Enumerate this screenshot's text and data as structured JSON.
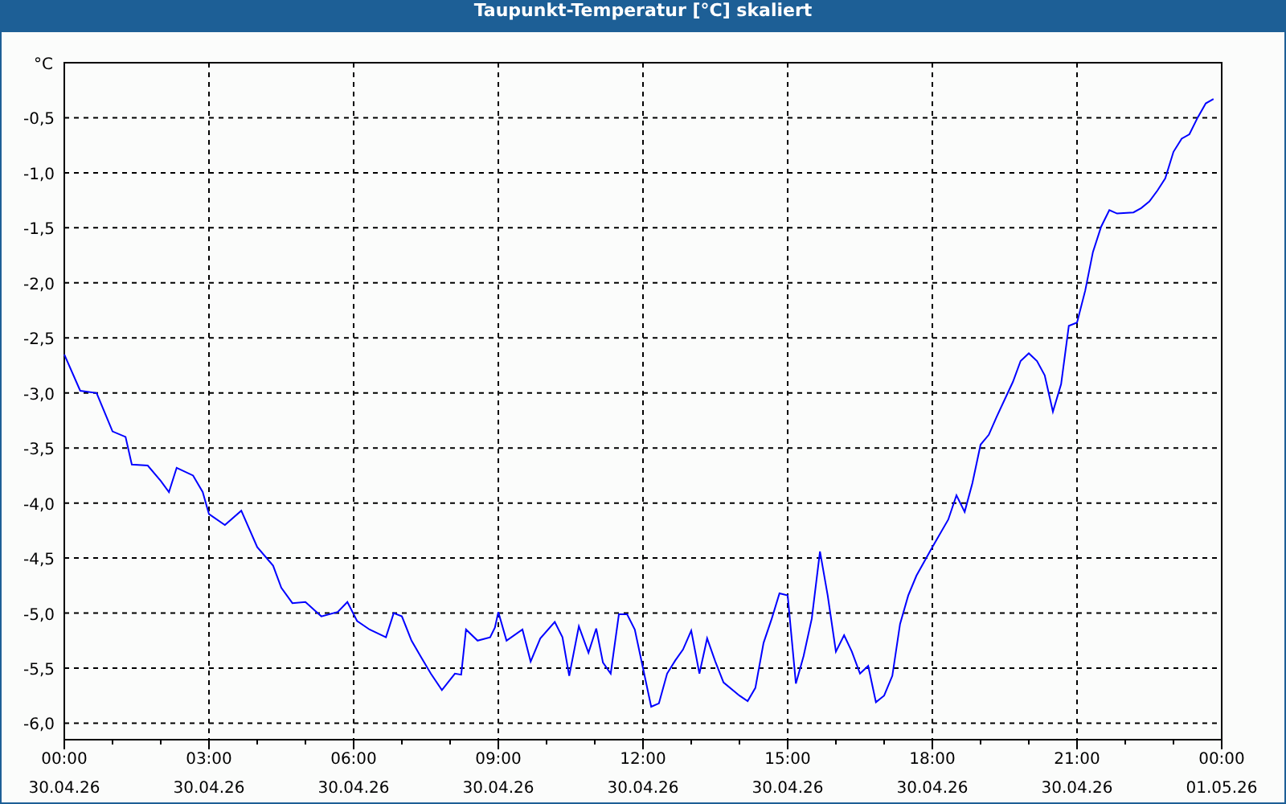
{
  "window": {
    "title": "Taupunkt-Temperatur [°C] skaliert"
  },
  "chart": {
    "chart_data": {
      "type": "line",
      "ylabel": "°C",
      "xlim": [
        0,
        24
      ],
      "ylim": [
        -6.15,
        0
      ],
      "xticks": [
        {
          "value": 0,
          "label": "00:00"
        },
        {
          "value": 3,
          "label": "03:00"
        },
        {
          "value": 6,
          "label": "06:00"
        },
        {
          "value": 9,
          "label": "09:00"
        },
        {
          "value": 12,
          "label": "12:00"
        },
        {
          "value": 15,
          "label": "15:00"
        },
        {
          "value": 18,
          "label": "18:00"
        },
        {
          "value": 21,
          "label": "21:00"
        },
        {
          "value": 24,
          "label": "00:00"
        }
      ],
      "annotations": [
        "30.04.26",
        "30.04.26",
        "30.04.26",
        "30.04.26",
        "30.04.26",
        "30.04.26",
        "30.04.26",
        "30.04.26",
        "01.05.26"
      ],
      "grid": true,
      "yticks": [
        {
          "value": -0.5,
          "label": "-0,5"
        },
        {
          "value": -1,
          "label": "-1,0"
        },
        {
          "value": -1.5,
          "label": "-1,5"
        },
        {
          "value": -2,
          "label": "-2,0"
        },
        {
          "value": -2.5,
          "label": "-2,5"
        },
        {
          "value": -3,
          "label": "-3,0"
        },
        {
          "value": -3.5,
          "label": "-3,5"
        },
        {
          "value": -4,
          "label": "-4,0"
        },
        {
          "value": -4.5,
          "label": "-4,5"
        },
        {
          "value": -5,
          "label": "-5,0"
        },
        {
          "value": -5.5,
          "label": "-5,5"
        },
        {
          "value": -6,
          "label": "-6,0"
        }
      ],
      "x": [
        0,
        0.33,
        0.67,
        1,
        1.27,
        1.4,
        1.73,
        2,
        2.17,
        2.33,
        2.67,
        2.87,
        3,
        3.33,
        3.67,
        4,
        4.33,
        4.5,
        4.73,
        5,
        5.33,
        5.67,
        5.87,
        6.07,
        6.33,
        6.67,
        6.83,
        7,
        7.2,
        7.4,
        7.6,
        7.83,
        8.1,
        8.23,
        8.33,
        8.57,
        8.83,
        8.93,
        9,
        9.17,
        9.5,
        9.67,
        9.87,
        10.17,
        10.33,
        10.47,
        10.67,
        10.87,
        11.03,
        11.17,
        11.33,
        11.5,
        11.67,
        11.83,
        12,
        12.17,
        12.33,
        12.5,
        12.67,
        12.83,
        13,
        13.17,
        13.33,
        13.5,
        13.67,
        14,
        14.17,
        14.33,
        14.5,
        14.67,
        14.83,
        15,
        15.17,
        15.33,
        15.5,
        15.67,
        15.83,
        16,
        16.17,
        16.33,
        16.5,
        16.67,
        16.83,
        17,
        17.17,
        17.33,
        17.5,
        17.67,
        18,
        18.33,
        18.5,
        18.67,
        18.83,
        19,
        19.17,
        19.33,
        19.67,
        19.83,
        20,
        20.17,
        20.33,
        20.5,
        20.67,
        20.83,
        21,
        21.17,
        21.33,
        21.5,
        21.67,
        21.83,
        22.17,
        22.33,
        22.5,
        22.67,
        22.83,
        23,
        23.17,
        23.33,
        23.5,
        23.67,
        23.83
      ],
      "series": [
        {
          "color": "#0000ff",
          "values": [
            -2.65,
            -2.98,
            -3.0,
            -3.35,
            -3.4,
            -3.65,
            -3.66,
            -3.8,
            -3.9,
            -3.68,
            -3.75,
            -3.9,
            -4.1,
            -4.2,
            -4.07,
            -4.4,
            -4.57,
            -4.77,
            -4.91,
            -4.9,
            -5.03,
            -4.99,
            -4.9,
            -5.07,
            -5.15,
            -5.22,
            -5.0,
            -5.03,
            -5.25,
            -5.4,
            -5.55,
            -5.7,
            -5.55,
            -5.56,
            -5.15,
            -5.25,
            -5.22,
            -5.13,
            -4.99,
            -5.25,
            -5.15,
            -5.44,
            -5.23,
            -5.08,
            -5.22,
            -5.57,
            -5.12,
            -5.36,
            -5.14,
            -5.45,
            -5.55,
            -5.01,
            -5.01,
            -5.15,
            -5.5,
            -5.85,
            -5.82,
            -5.55,
            -5.43,
            -5.33,
            -5.16,
            -5.55,
            -5.23,
            -5.44,
            -5.63,
            -5.75,
            -5.8,
            -5.68,
            -5.27,
            -5.05,
            -4.82,
            -4.84,
            -5.64,
            -5.39,
            -5.05,
            -4.44,
            -4.84,
            -5.35,
            -5.2,
            -5.35,
            -5.55,
            -5.48,
            -5.81,
            -5.75,
            -5.57,
            -5.1,
            -4.84,
            -4.66,
            -4.4,
            -4.15,
            -3.93,
            -4.08,
            -3.82,
            -3.47,
            -3.38,
            -3.22,
            -2.9,
            -2.71,
            -2.64,
            -2.71,
            -2.84,
            -3.17,
            -2.92,
            -2.39,
            -2.36,
            -2.07,
            -1.72,
            -1.49,
            -1.34,
            -1.37,
            -1.36,
            -1.32,
            -1.26,
            -1.16,
            -1.05,
            -0.81,
            -0.69,
            -0.65,
            -0.5,
            -0.37,
            -0.33
          ]
        }
      ]
    }
  }
}
